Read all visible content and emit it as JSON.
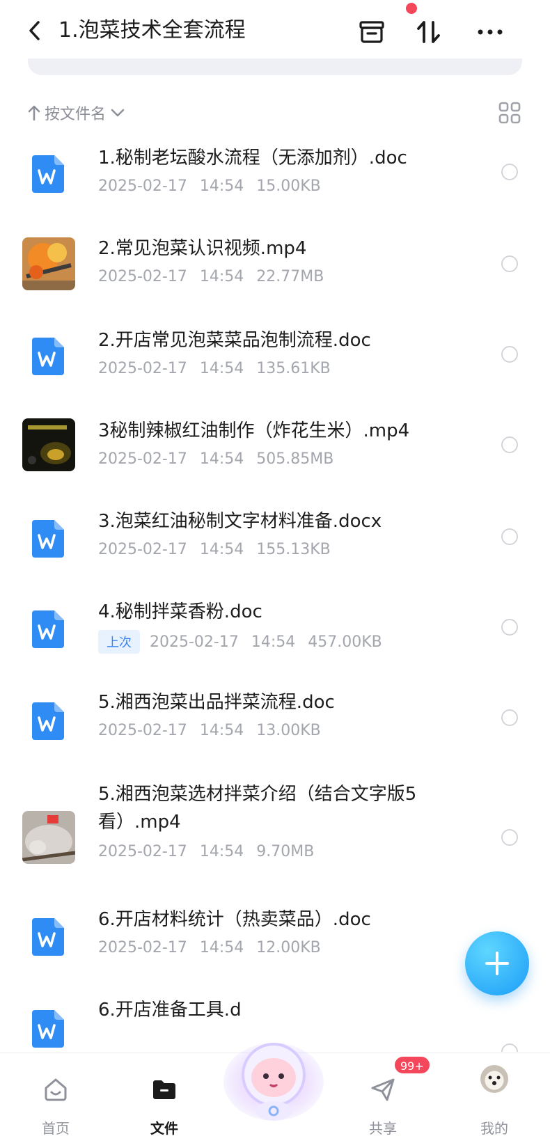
{
  "header": {
    "title": "1.泡菜技术全套流程"
  },
  "sortbar": {
    "sort_label": "按文件名"
  },
  "files": [
    {
      "name": "1.秘制老坛酸水流程（无添加剂）.doc",
      "date": "2025-02-17",
      "time": "14:54",
      "size": "15.00KB",
      "type": "doc"
    },
    {
      "name": "2.常见泡菜认识视频.mp4",
      "date": "2025-02-17",
      "time": "14:54",
      "size": "22.77MB",
      "type": "video"
    },
    {
      "name": "2.开店常见泡菜菜品泡制流程.doc",
      "date": "2025-02-17",
      "time": "14:54",
      "size": "135.61KB",
      "type": "doc"
    },
    {
      "name": "3秘制辣椒红油制作（炸花生米）.mp4",
      "date": "2025-02-17",
      "time": "14:54",
      "size": "505.85MB",
      "type": "video"
    },
    {
      "name": "3.泡菜红油秘制文字材料准备.docx",
      "date": "2025-02-17",
      "time": "14:54",
      "size": "155.13KB",
      "type": "doc"
    },
    {
      "name": "4.秘制拌菜香粉.doc",
      "badge": "上次",
      "date": "2025-02-17",
      "time": "14:54",
      "size": "457.00KB",
      "type": "doc"
    },
    {
      "name": "5.湘西泡菜出品拌菜流程.doc",
      "date": "2025-02-17",
      "time": "14:54",
      "size": "13.00KB",
      "type": "doc"
    },
    {
      "name": "5.湘西泡菜选材拌菜介绍（结合文字版5看）.mp4",
      "date": "2025-02-17",
      "time": "14:54",
      "size": "9.70MB",
      "type": "video"
    },
    {
      "name": "6.开店材料统计（热卖菜品）.doc",
      "date": "2025-02-17",
      "time": "14:54",
      "size": "12.00KB",
      "type": "doc"
    },
    {
      "name": "6.开店准备工具.d",
      "type": "doc"
    }
  ],
  "tabbar": {
    "home": "首页",
    "files": "文件",
    "share": "共享",
    "mine": "我的",
    "share_badge": "99+"
  },
  "colors": {
    "accent": "#2f8cf5",
    "fab": "#1a9cf7",
    "badge": "#f5475b"
  }
}
